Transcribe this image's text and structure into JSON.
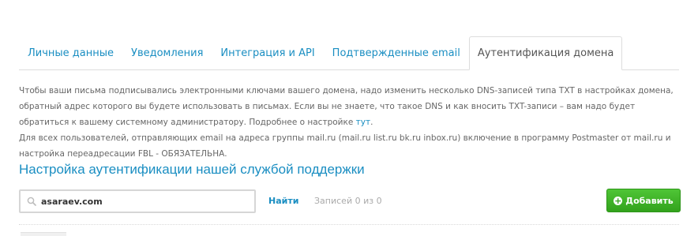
{
  "tabs": [
    {
      "label": "Личные данные"
    },
    {
      "label": "Уведомления"
    },
    {
      "label": "Интеграция и API"
    },
    {
      "label": "Подтвержденные email"
    },
    {
      "label": "Аутентификация домена"
    }
  ],
  "active_tab_index": 4,
  "description": {
    "line1_prefix": "Чтобы ваши письма подписывались электронными ключами вашего домена, надо изменить несколько DNS-записей типа TXT в настройках домена, обратный адрес которого вы будете использовать в письмах. Если вы не знаете, что такое DNS и как вносить TXT-записи – вам надо будет обратиться к вашему системному администратору. Подробнее о настройке ",
    "link": "тут",
    "line1_suffix": ".",
    "line2": " Для всех пользователей, отправляющих email на адреса группы mail.ru (mail.ru list.ru bk.ru inbox.ru) включение в программу Postmaster от mail.ru и настройка переадресации FBL - ОБЯЗАТЕЛЬНА."
  },
  "section_title": "Настройка аутентификации нашей службой поддержки",
  "search": {
    "value": "asaraev.com",
    "icon": "search-icon"
  },
  "find_label": "Найти",
  "records_label": "Записей 0 из 0",
  "add_label": "Добавить",
  "colors": {
    "link": "#1a8ec2",
    "add_button": "#3bb024"
  }
}
